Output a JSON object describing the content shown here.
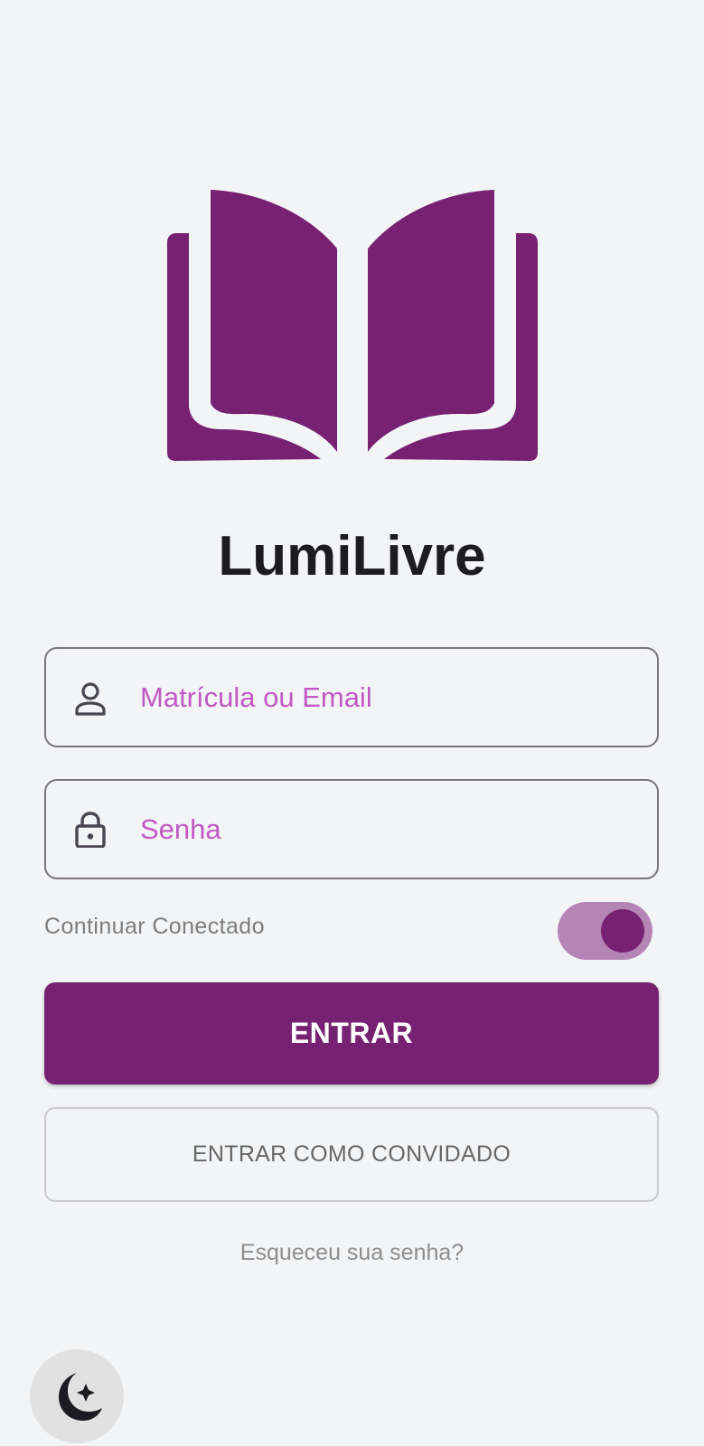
{
  "app": {
    "title": "LumiLivre"
  },
  "login": {
    "username_placeholder": "Matrícula ou Email",
    "password_placeholder": "Senha",
    "remember_label": "Continuar Conectado",
    "remember_enabled": true,
    "submit_label": "ENTRAR",
    "guest_label": "ENTRAR COMO CONVIDADO",
    "forgot_label": "Esqueceu sua senha?"
  },
  "icons": {
    "logo": "open-book-icon",
    "username": "user-icon",
    "password": "lock-icon",
    "theme": "moon-icon"
  },
  "colors": {
    "brand": "#772172",
    "background": "#f3f4f6",
    "placeholder": "#c158c4",
    "toggle_track": "#b585b5",
    "title": "#1c1b1f"
  }
}
